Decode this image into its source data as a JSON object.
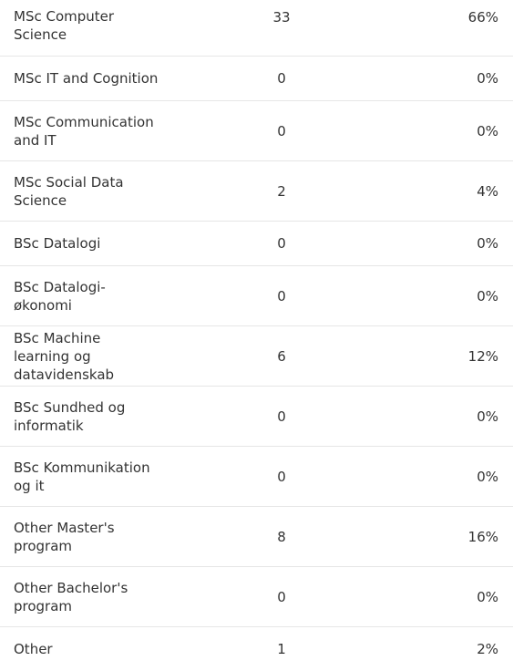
{
  "table": {
    "rows": [
      {
        "name": "MSc Computer Science",
        "count": "33",
        "percent": "66%"
      },
      {
        "name": "MSc IT and Cognition",
        "count": "0",
        "percent": "0%"
      },
      {
        "name": "MSc Communication and IT",
        "count": "0",
        "percent": "0%"
      },
      {
        "name": "MSc Social Data Science",
        "count": "2",
        "percent": "4%"
      },
      {
        "name": "BSc Datalogi",
        "count": "0",
        "percent": "0%"
      },
      {
        "name": "BSc Datalogi-økonomi",
        "count": "0",
        "percent": "0%"
      },
      {
        "name": "BSc Machine learning og datavidenskab",
        "count": "6",
        "percent": "12%"
      },
      {
        "name": "BSc Sundhed og informatik",
        "count": "0",
        "percent": "0%"
      },
      {
        "name": "BSc Kommunikation og it",
        "count": "0",
        "percent": "0%"
      },
      {
        "name": "Other Master's program",
        "count": "8",
        "percent": "16%"
      },
      {
        "name": "Other Bachelor's program",
        "count": "0",
        "percent": "0%"
      },
      {
        "name": "Other",
        "count": "1",
        "percent": "2%"
      }
    ]
  }
}
